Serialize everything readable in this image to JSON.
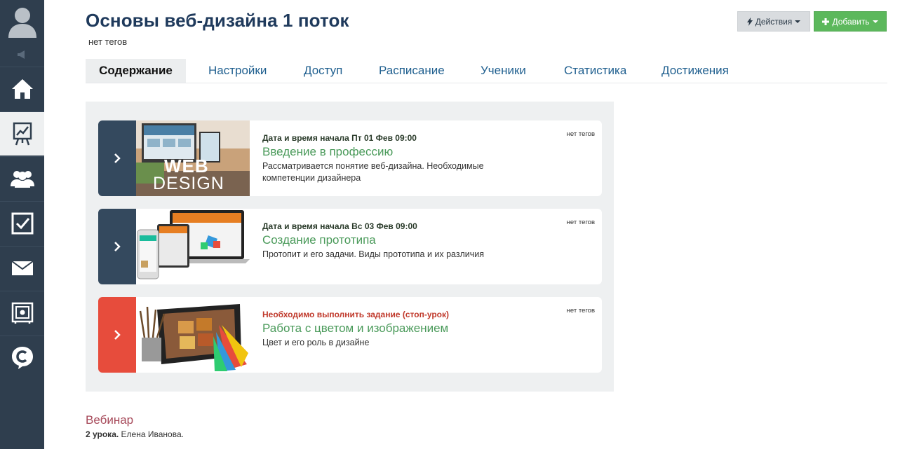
{
  "header": {
    "title": "Основы веб-дизайна 1 поток",
    "tags": "нет тегов",
    "actions_label": "Действия",
    "add_label": "Добавить"
  },
  "tabs": [
    {
      "label": "Содержание",
      "active": true
    },
    {
      "label": "Настройки"
    },
    {
      "label": "Доступ"
    },
    {
      "label": "Расписание"
    },
    {
      "label": "Ученики"
    },
    {
      "label": "Статистика"
    },
    {
      "label": "Достижения"
    }
  ],
  "sidebar": {
    "items": [
      {
        "icon": "home-icon"
      },
      {
        "icon": "presentation-chart-icon",
        "active": true
      },
      {
        "icon": "users-icon"
      },
      {
        "icon": "checkbox-icon"
      },
      {
        "icon": "mail-icon"
      },
      {
        "icon": "safe-icon"
      },
      {
        "icon": "chat-c-icon"
      }
    ]
  },
  "lessons": [
    {
      "start": "Дата и время начала Пт 01 Фев 09:00",
      "name": "Введение в профессию",
      "desc": "Рассматривается понятие веб-дизайна. Необходимые компетенции дизайнера",
      "tags": "нет тегов",
      "color": "#34495e",
      "thumb_text": "WEB DESIGN"
    },
    {
      "start": "Дата и время начала Вс 03 Фев 09:00",
      "name": "Создание прототипа",
      "desc": "Протопит и его задачи. Виды прототипа и их различия",
      "tags": "нет тегов",
      "color": "#34495e"
    },
    {
      "start": "Необходимо выполнить задание (стоп-урок)",
      "name": "Работа с цветом и изображением",
      "desc": "Цвет и его роль в дизайне",
      "tags": "нет тегов",
      "color": "#e74c3c",
      "stop": true
    }
  ],
  "webinar": {
    "title": "Вебинар",
    "count": "2 урока.",
    "author": "Елена Иванова."
  },
  "colors": {
    "sidebar": "#2f3e4e",
    "title": "#1f3a5c",
    "tab_link": "#1f5f8f",
    "lesson_name": "#4a9a5a",
    "add_button": "#5cb85c",
    "stop_lesson": "#e74c3c"
  }
}
